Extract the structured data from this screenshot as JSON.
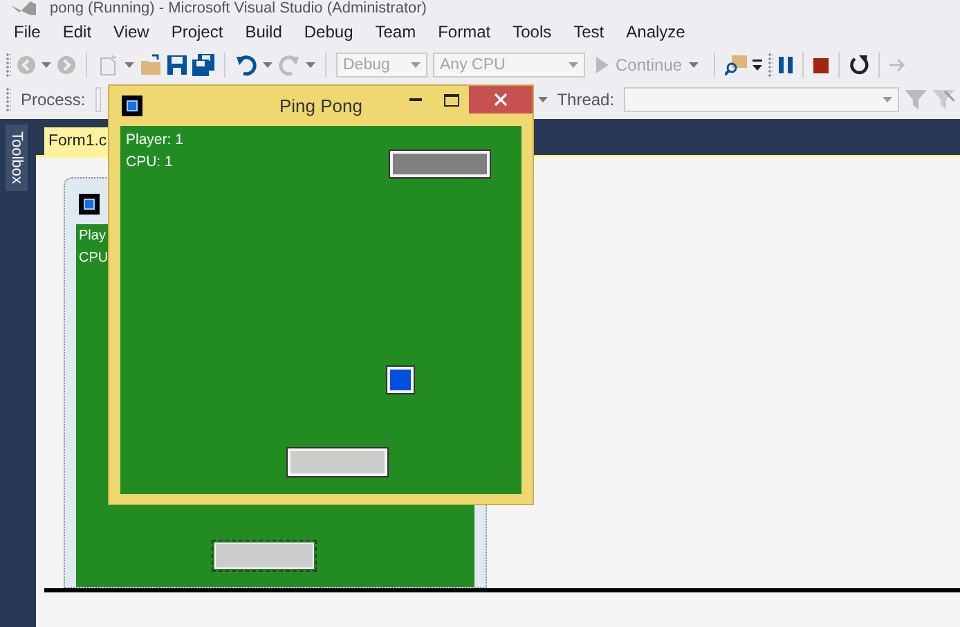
{
  "window": {
    "title": "pong (Running) - Microsoft Visual Studio  (Administrator)"
  },
  "menu": [
    {
      "label": "File"
    },
    {
      "label": "Edit"
    },
    {
      "label": "View"
    },
    {
      "label": "Project"
    },
    {
      "label": "Build"
    },
    {
      "label": "Debug"
    },
    {
      "label": "Team"
    },
    {
      "label": "Format"
    },
    {
      "label": "Tools"
    },
    {
      "label": "Test"
    },
    {
      "label": "Analyze"
    }
  ],
  "toolbar": {
    "configuration": {
      "value": "Debug",
      "disabled": true
    },
    "platform": {
      "value": "Any CPU",
      "disabled": true
    },
    "continue_label": "Continue"
  },
  "debug_location": {
    "process_label": "Process:",
    "thread_label": "Thread:"
  },
  "toolbox": {
    "label": "Toolbox"
  },
  "tabs": [
    {
      "label": "Form1.c",
      "selected": true
    }
  ],
  "designer_form": {
    "labels": [
      "Play",
      "CPU"
    ]
  },
  "game_window": {
    "title": "Ping Pong",
    "labels": [
      "Player: 1",
      "CPU: 1"
    ]
  }
}
